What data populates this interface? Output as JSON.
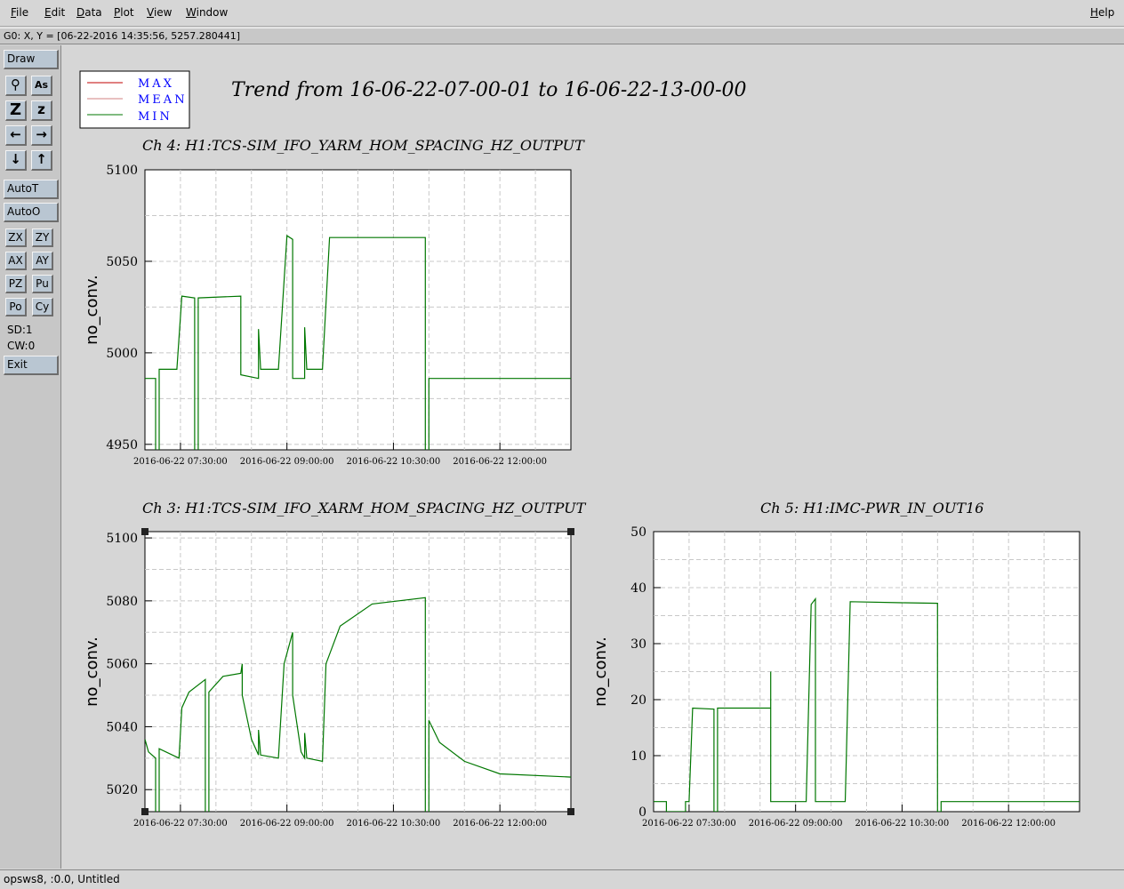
{
  "menubar": {
    "file": "File",
    "edit": "Edit",
    "data": "Data",
    "plot": "Plot",
    "view": "View",
    "window": "Window",
    "help": "Help"
  },
  "status": "G0: X, Y = [06-22-2016 14:35:56, 5257.280441]",
  "toolbar": {
    "draw": "Draw",
    "icons": [
      "magnify-icon",
      "text-size-icon",
      "zoom-out-icon",
      "zoom-in-icon",
      "left-arrow-icon",
      "right-arrow-icon",
      "down-arrow-icon",
      "up-arrow-icon"
    ],
    "icon_glyphs": [
      "⚲",
      "As",
      "Z",
      "z",
      "←",
      "→",
      "↓",
      "↑"
    ],
    "autot": "AutoT",
    "autoo": "AutoO",
    "small": [
      "ZX",
      "ZY",
      "AX",
      "AY",
      "PZ",
      "Pu",
      "Po",
      "Cy"
    ],
    "sd": "SD:1",
    "cw": "CW:0",
    "exit": "Exit"
  },
  "bottom": "opsws8, :0.0, Untitled",
  "legend": [
    {
      "label": "MAX",
      "color": "#c00000"
    },
    {
      "label": "MEAN",
      "color": "#d08080"
    },
    {
      "label": "MIN",
      "color": "#007700"
    }
  ],
  "legend_text_color": "#0000ff",
  "trend_title": "Trend from 16-06-22-07-00-01 to 16-06-22-13-00-00",
  "chart_data": [
    {
      "type": "line",
      "title": "Ch 4: H1:TCS-SIM_IFO_YARM_HOM_SPACING_HZ_OUTPUT",
      "ylabel": "no_conv.",
      "xlabel": "",
      "xlim": [
        7.0,
        13.0
      ],
      "ylim": [
        4947,
        5100
      ],
      "yticks": [
        4950,
        5000,
        5050,
        5100
      ],
      "xticks": [
        {
          "x": 7.5,
          "label": "2016-06-22 07:30:00"
        },
        {
          "x": 9.0,
          "label": "2016-06-22 09:00:00"
        },
        {
          "x": 10.5,
          "label": "2016-06-22 10:30:00"
        },
        {
          "x": 12.0,
          "label": "2016-06-22 12:00:00"
        }
      ],
      "grid": true,
      "series": [
        {
          "name": "MIN",
          "color": "#007700",
          "points": [
            [
              7.0,
              4986
            ],
            [
              7.15,
              4986
            ],
            [
              7.15,
              4930
            ],
            [
              7.2,
              4930
            ],
            [
              7.2,
              4991
            ],
            [
              7.45,
              4991
            ],
            [
              7.52,
              5031
            ],
            [
              7.7,
              5030
            ],
            [
              7.7,
              4930
            ],
            [
              7.75,
              4930
            ],
            [
              7.75,
              5030
            ],
            [
              8.35,
              5031
            ],
            [
              8.35,
              4988
            ],
            [
              8.6,
              4986
            ],
            [
              8.6,
              5013
            ],
            [
              8.63,
              4991
            ],
            [
              8.88,
              4991
            ],
            [
              9.0,
              5064
            ],
            [
              9.08,
              5062
            ],
            [
              9.08,
              4986
            ],
            [
              9.25,
              4986
            ],
            [
              9.25,
              5014
            ],
            [
              9.28,
              4991
            ],
            [
              9.5,
              4991
            ],
            [
              9.6,
              5063
            ],
            [
              10.95,
              5063
            ],
            [
              10.95,
              4930
            ],
            [
              11.0,
              4930
            ],
            [
              11.0,
              4986
            ],
            [
              13.0,
              4986
            ]
          ]
        }
      ]
    },
    {
      "type": "line",
      "title": "Ch 3: H1:TCS-SIM_IFO_XARM_HOM_SPACING_HZ_OUTPUT",
      "ylabel": "no_conv.",
      "xlabel": "",
      "xlim": [
        7.0,
        13.0
      ],
      "ylim": [
        5013,
        5102
      ],
      "yticks": [
        5020,
        5040,
        5060,
        5080,
        5100
      ],
      "xticks": [
        {
          "x": 7.5,
          "label": "2016-06-22 07:30:00"
        },
        {
          "x": 9.0,
          "label": "2016-06-22 09:00:00"
        },
        {
          "x": 10.5,
          "label": "2016-06-22 10:30:00"
        },
        {
          "x": 12.0,
          "label": "2016-06-22 12:00:00"
        }
      ],
      "grid": true,
      "series": [
        {
          "name": "MIN",
          "color": "#007700",
          "points": [
            [
              7.0,
              5036
            ],
            [
              7.05,
              5032
            ],
            [
              7.15,
              5030
            ],
            [
              7.15,
              5010
            ],
            [
              7.2,
              5010
            ],
            [
              7.2,
              5033
            ],
            [
              7.48,
              5030
            ],
            [
              7.52,
              5046
            ],
            [
              7.62,
              5051
            ],
            [
              7.85,
              5055
            ],
            [
              7.85,
              5010
            ],
            [
              7.9,
              5010
            ],
            [
              7.9,
              5051
            ],
            [
              8.1,
              5056
            ],
            [
              8.35,
              5057
            ],
            [
              8.37,
              5060
            ],
            [
              8.37,
              5050
            ],
            [
              8.5,
              5036
            ],
            [
              8.6,
              5031
            ],
            [
              8.6,
              5039
            ],
            [
              8.63,
              5031
            ],
            [
              8.88,
              5030
            ],
            [
              8.96,
              5060
            ],
            [
              9.08,
              5070
            ],
            [
              9.08,
              5050
            ],
            [
              9.2,
              5032
            ],
            [
              9.25,
              5030
            ],
            [
              9.25,
              5038
            ],
            [
              9.28,
              5030
            ],
            [
              9.5,
              5029
            ],
            [
              9.55,
              5060
            ],
            [
              9.75,
              5072
            ],
            [
              10.2,
              5079
            ],
            [
              10.95,
              5081
            ],
            [
              10.95,
              5010
            ],
            [
              11.0,
              5010
            ],
            [
              11.0,
              5042
            ],
            [
              11.15,
              5035
            ],
            [
              11.5,
              5029
            ],
            [
              12.0,
              5025
            ],
            [
              13.0,
              5024
            ]
          ]
        }
      ]
    },
    {
      "type": "line",
      "title": "Ch 5: H1:IMC-PWR_IN_OUT16",
      "ylabel": "no_conv.",
      "xlabel": "",
      "xlim": [
        7.0,
        13.0
      ],
      "ylim": [
        0,
        50
      ],
      "yticks": [
        0,
        10,
        20,
        30,
        40,
        50
      ],
      "xticks": [
        {
          "x": 7.5,
          "label": "2016-06-22 07:30:00"
        },
        {
          "x": 9.0,
          "label": "2016-06-22 09:00:00"
        },
        {
          "x": 10.5,
          "label": "2016-06-22 10:30:00"
        },
        {
          "x": 12.0,
          "label": "2016-06-22 12:00:00"
        }
      ],
      "grid": true,
      "series": [
        {
          "name": "MIN",
          "color": "#007700",
          "points": [
            [
              7.0,
              1.8
            ],
            [
              7.18,
              1.8
            ],
            [
              7.18,
              0
            ],
            [
              7.45,
              0
            ],
            [
              7.45,
              1.8
            ],
            [
              7.5,
              1.8
            ],
            [
              7.55,
              18.5
            ],
            [
              7.85,
              18.3
            ],
            [
              7.85,
              0
            ],
            [
              7.9,
              0
            ],
            [
              7.9,
              18.5
            ],
            [
              8.65,
              18.5
            ],
            [
              8.65,
              25
            ],
            [
              8.65,
              1.8
            ],
            [
              9.15,
              1.8
            ],
            [
              9.22,
              37
            ],
            [
              9.28,
              38
            ],
            [
              9.28,
              1.8
            ],
            [
              9.7,
              1.8
            ],
            [
              9.77,
              37.5
            ],
            [
              10.5,
              37.3
            ],
            [
              11.0,
              37.2
            ],
            [
              11.0,
              0
            ],
            [
              11.05,
              0
            ],
            [
              11.05,
              1.8
            ],
            [
              13.0,
              1.8
            ]
          ]
        }
      ]
    }
  ]
}
